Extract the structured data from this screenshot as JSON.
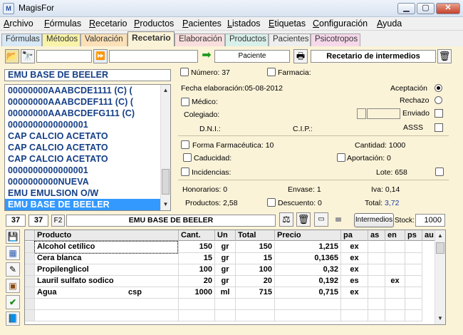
{
  "window": {
    "title": "MagisFor",
    "minimize": "▁",
    "maximize": "▢",
    "close": "✕"
  },
  "menu": [
    "Archivo",
    "Fórmulas",
    "Recetario",
    "Productos",
    "Pacientes",
    "Listados",
    "Etiquetas",
    "Configuración",
    "Ayuda"
  ],
  "tabs": [
    {
      "label": "Fórmulas",
      "color": "#d7e8f6"
    },
    {
      "label": "Métodos",
      "color": "#f8f3a8"
    },
    {
      "label": "Valoración",
      "color": "#fbe0b8"
    },
    {
      "label": "Recetario",
      "color": "#fbf3d8"
    },
    {
      "label": "Elaboración",
      "color": "#fadede"
    },
    {
      "label": "Productos",
      "color": "#d8f0ea"
    },
    {
      "label": "Pacientes",
      "color": "#eeeeee"
    },
    {
      "label": "Psicotropos",
      "color": "#f6d8ea"
    }
  ],
  "toolbar": {
    "patient_button": "Paciente",
    "recetario_field": "Recetario de intermedios"
  },
  "header": {
    "name_field": "EMU BASE DE BEELER",
    "numero_label": "Número:",
    "numero_value": "37",
    "farmacia_label": "Farmacia:"
  },
  "list": {
    "items": [
      "00000000AAABCDE1111 (C) (",
      "00000000AAABCDEF111 (C) (",
      "00000000AAABCDEFG111 (C)",
      "0000000000000001",
      "CAP CALCIO ACETATO",
      "CAP CALCIO ACETATO",
      "CAP CALCIO ACETATO",
      "0000000000000001",
      "0000000000NUEVA",
      "EMU EMULSION O/W",
      "EMU BASE DE BEELER"
    ],
    "selected_index": 10
  },
  "form": {
    "fecha_label": "Fecha elaboración:",
    "fecha_value": "05-08-2012",
    "aceptacion": "Aceptación",
    "rechazo": "Rechazo",
    "enviado": "Enviado",
    "asss": "ASSS",
    "medico": "Médico:",
    "colegiado": "Colegiado:",
    "dni": "D.N.I.:",
    "cip": "C.I.P.:",
    "forma_label": "Forma Farmacéutica:",
    "forma_value": "10",
    "cantidad_label": "Cantidad:",
    "cantidad_value": "1000",
    "caducidad": "Caducidad:",
    "aportacion_label": "Aportación:",
    "aportacion_value": "0",
    "incidencias": "Incidencias:",
    "lote_label": "Lote:",
    "lote_value": "658",
    "honorarios_label": "Honorarios:",
    "honorarios_value": "0",
    "envase_label": "Envase:",
    "envase_value": "1",
    "iva_label": "Iva:",
    "iva_value": "0,14",
    "productos_label": "Productos:",
    "productos_value": "2,58",
    "descuento_label": "Descuento:",
    "descuento_value": "0",
    "total_label": "Total:",
    "total_value": "3,72"
  },
  "bar2": {
    "num1": "37",
    "num2": "37",
    "key": "F2",
    "name": "EMU BASE DE BEELER",
    "intermedios": "Intermedios",
    "stock_label": "Stock:",
    "stock_value": "1000"
  },
  "grid": {
    "columns": [
      "Producto",
      "Cant.",
      "Un",
      "Total",
      "Precio",
      "pa",
      "as",
      "en",
      "ps",
      "au"
    ],
    "rows": [
      {
        "producto": "Alcohol cetílico",
        "extra": "",
        "cant": "150",
        "un": "gr",
        "total": "150",
        "precio": "1,215",
        "pa": "ex",
        "as": "",
        "en": "",
        "ps": ""
      },
      {
        "producto": "Cera blanca",
        "extra": "",
        "cant": "15",
        "un": "gr",
        "total": "15",
        "precio": "0,1365",
        "pa": "ex",
        "as": "",
        "en": "",
        "ps": ""
      },
      {
        "producto": "Propilenglicol",
        "extra": "",
        "cant": "100",
        "un": "gr",
        "total": "100",
        "precio": "0,32",
        "pa": "ex",
        "as": "",
        "en": "",
        "ps": ""
      },
      {
        "producto": "Lauril sulfato sodico",
        "extra": "",
        "cant": "20",
        "un": "gr",
        "total": "20",
        "precio": "0,192",
        "pa": "es",
        "as": "",
        "en": "ex",
        "ps": ""
      },
      {
        "producto": "Agua",
        "extra": "csp",
        "cant": "1000",
        "un": "ml",
        "total": "715",
        "precio": "0,715",
        "pa": "ex",
        "as": "",
        "en": "",
        "ps": ""
      }
    ]
  },
  "icons": {
    "open": "folder-open-icon",
    "search": "binoculars-icon",
    "next": "fast-forward-icon",
    "go": "green-arrow-icon",
    "print": "printer-icon",
    "delete": "trash-icon",
    "save": "save-icon",
    "calc": "calculator-icon",
    "edit": "edit-icon",
    "scale": "scale-icon",
    "check": "check-icon",
    "book": "book-icon"
  }
}
